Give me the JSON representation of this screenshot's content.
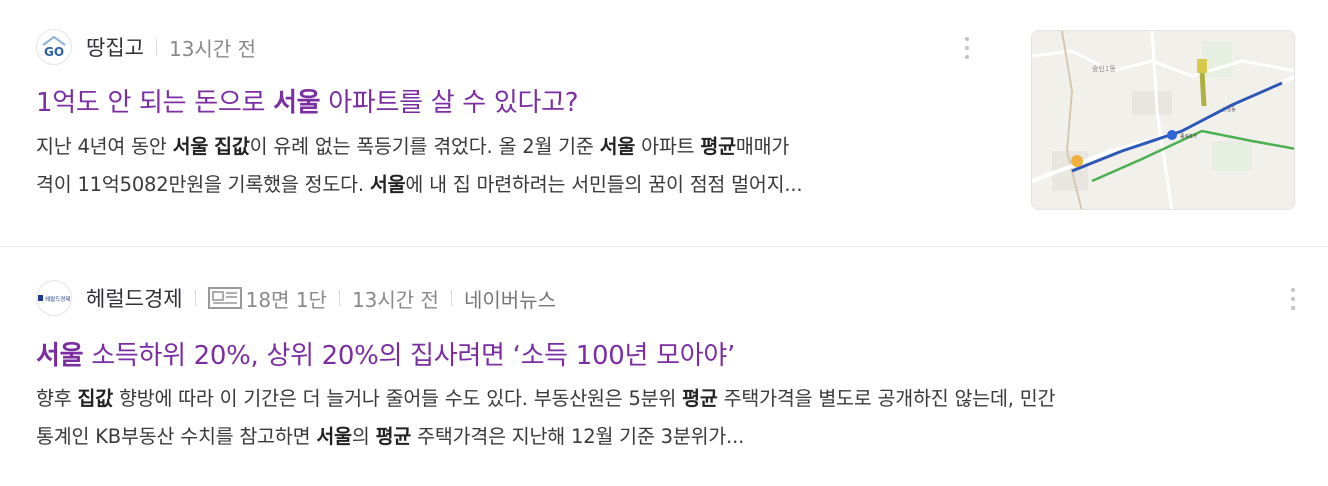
{
  "articles": [
    {
      "press": "땅집고",
      "time": "13시간 전",
      "title": [
        "1억도 안 되는 돈으로 ",
        "서울",
        " 아파트를 살 수 있다고?"
      ],
      "desc_lines": [
        [
          "지난 4년여 동안 ",
          "서울",
          " ",
          "집값",
          "이 유례 없는 폭등기를 겪었다. 올 2월 기준 ",
          "서울",
          " 아파트 ",
          "평균",
          "매매가"
        ],
        [
          "격이 11억5082만원을 기록했을 정도다. ",
          "서울",
          "에 내 집 마련하려는 서민들의 꿈이 점점 멀어지..."
        ]
      ],
      "thumbnail_icon": "map-thumbnail"
    },
    {
      "press": "헤럴드경제",
      "logo_text": "헤럴드경제",
      "page": "18면 1단",
      "time": "13시간 전",
      "naver_news": "네이버뉴스",
      "title": [
        "서울",
        " 소득하위 20%, 상위 20%의 집사려면 ‘소득 100년 모아야’"
      ],
      "desc_lines": [
        [
          "향후 ",
          "집값",
          " 향방에 따라 이 기간은 더 늘거나 줄어들 수도 있다. 부동산원은 5분위 ",
          "평균",
          " 주택가격을 별도로 공개하진 않는데, 민간"
        ],
        [
          "통계인 KB부동산 수치를 참고하면 ",
          "서울",
          "의 ",
          "평균",
          " 주택가격은 지난해 12월 기준 3분위가..."
        ]
      ]
    }
  ],
  "colors": {
    "title": "#7b2ea3",
    "meta": "#8a8a8a",
    "desc": "#3a3a3a"
  },
  "icons": [
    "go-logo-icon",
    "newspaper-icon",
    "more-vertical-icon"
  ]
}
